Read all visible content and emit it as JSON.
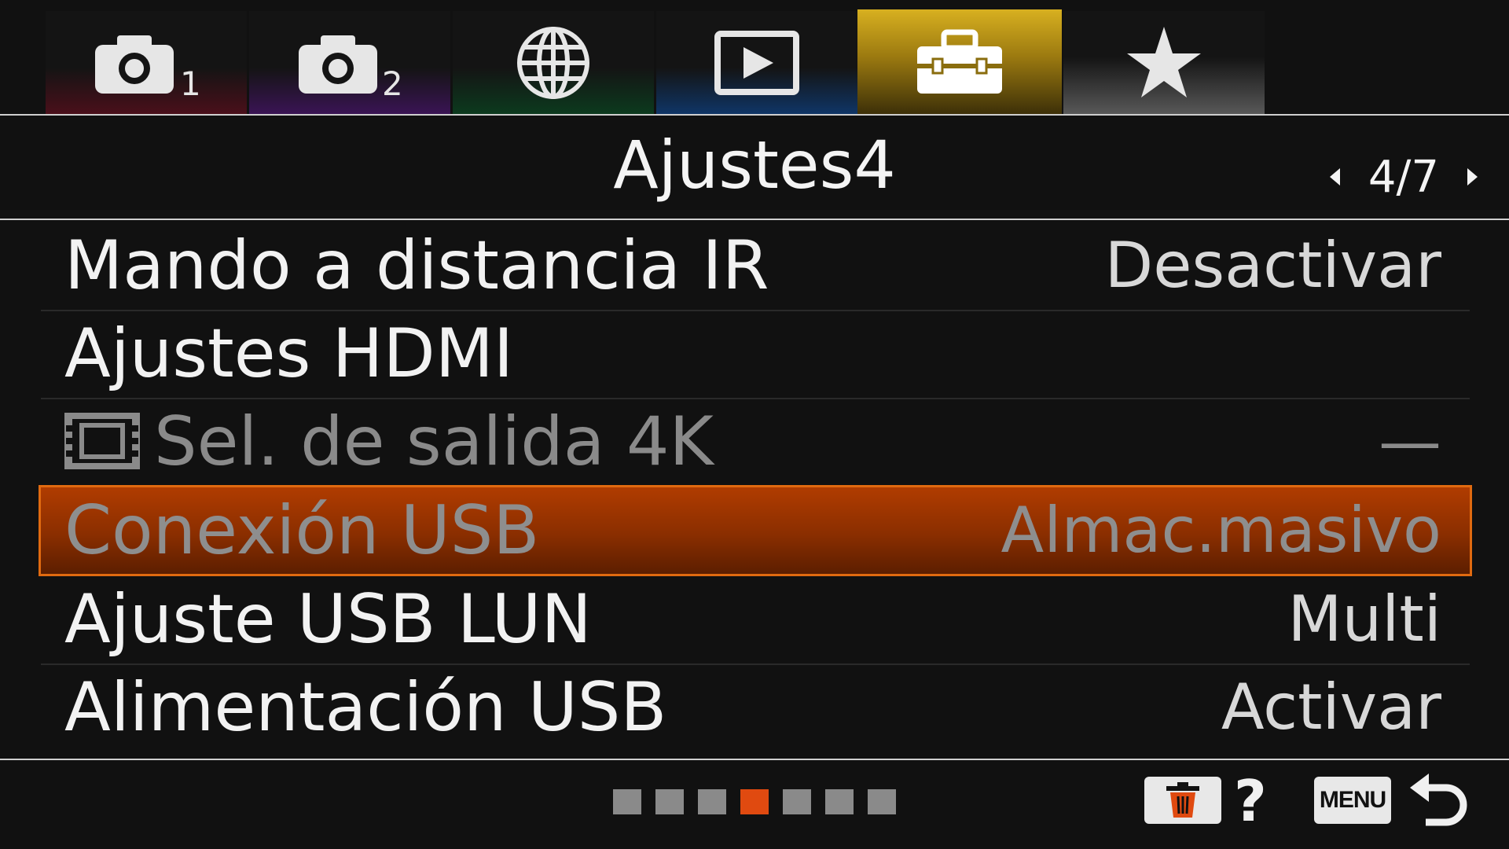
{
  "tabs": [
    {
      "icon": "camera-1-icon",
      "num": "1",
      "color": "#4a0f1a"
    },
    {
      "icon": "camera-2-icon",
      "num": "2",
      "color": "#3a1454"
    },
    {
      "icon": "globe-icon",
      "color": "#0c3a1e"
    },
    {
      "icon": "playback-icon",
      "color": "#0f3566"
    },
    {
      "icon": "toolbox-icon",
      "color": "#d8b020",
      "active": true
    },
    {
      "icon": "star-icon",
      "color": "#585858"
    }
  ],
  "page": {
    "title": "Ajustes4",
    "pager": "4/7"
  },
  "menu": {
    "items": [
      {
        "label": "Mando a distancia IR",
        "value": "Desactivar"
      },
      {
        "label": "Ajustes HDMI",
        "value": ""
      },
      {
        "label": "Sel. de salida 4K",
        "value": "—",
        "disabled": true,
        "icon": "movie-film-icon"
      },
      {
        "label": "Conexión USB",
        "value": "Almac.masivo",
        "selected": true
      },
      {
        "label": "Ajuste USB LUN",
        "value": "Multi"
      },
      {
        "label": "Alimentación USB",
        "value": "Activar"
      }
    ]
  },
  "footer": {
    "page_dots": 7,
    "active_dot": 4,
    "help_label": "?",
    "menu_label": "MENU",
    "accent": "#e04a10"
  }
}
